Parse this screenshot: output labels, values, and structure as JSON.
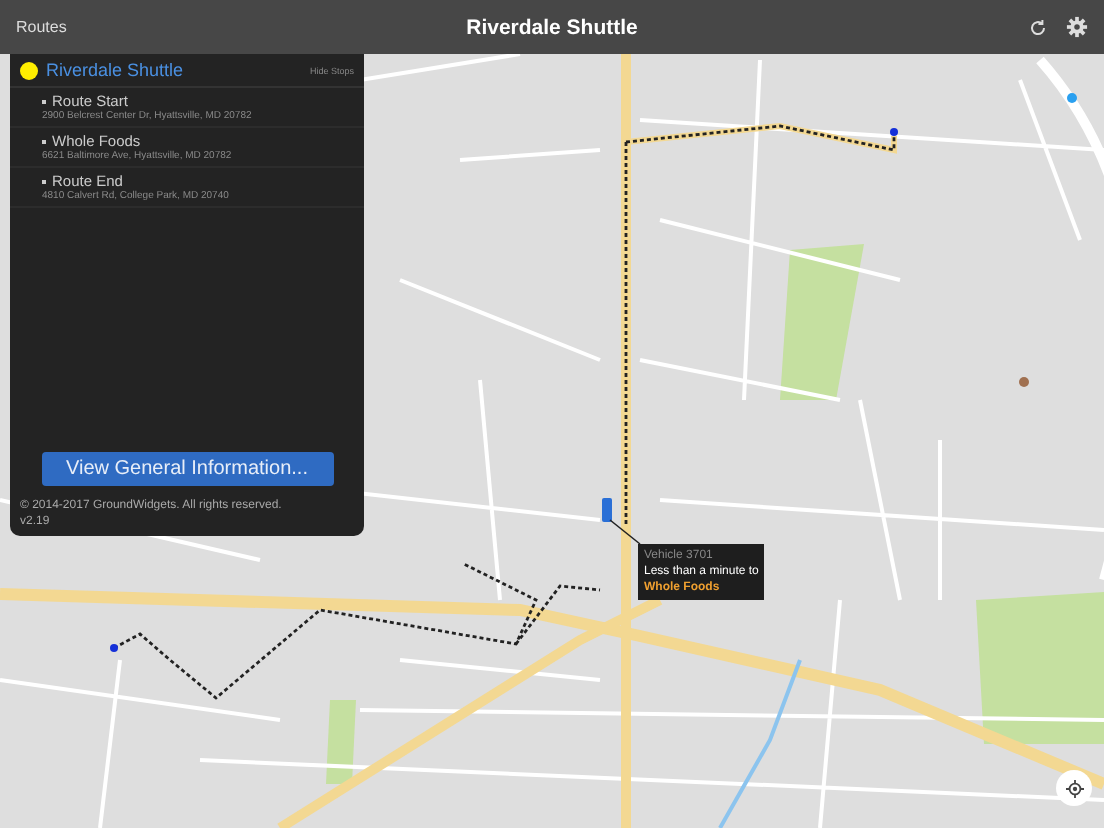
{
  "top_bar": {
    "back_label": "Routes",
    "title": "Riverdale Shuttle"
  },
  "routes_popover": {
    "route": {
      "name": "Riverdale Shuttle",
      "color": "#ffee00",
      "toggle_label": "Hide Stops"
    },
    "stops": [
      {
        "name": "Route Start",
        "address": "2900 Belcrest Center Dr, Hyattsville, MD 20782"
      },
      {
        "name": "Whole Foods",
        "address": "6621 Baltimore Ave, Hyattsville, MD 20782"
      },
      {
        "name": "Route End",
        "address": "4810 Calvert Rd, College Park, MD 20740"
      }
    ],
    "info_button": "View General Information...",
    "copyright": "© 2014-2017 GroundWidgets.  All rights reserved.",
    "version": "v2.19"
  },
  "vehicle_callout": {
    "vehicle": "Vehicle 3701",
    "eta": "Less than a minute to",
    "destination": "Whole Foods"
  }
}
